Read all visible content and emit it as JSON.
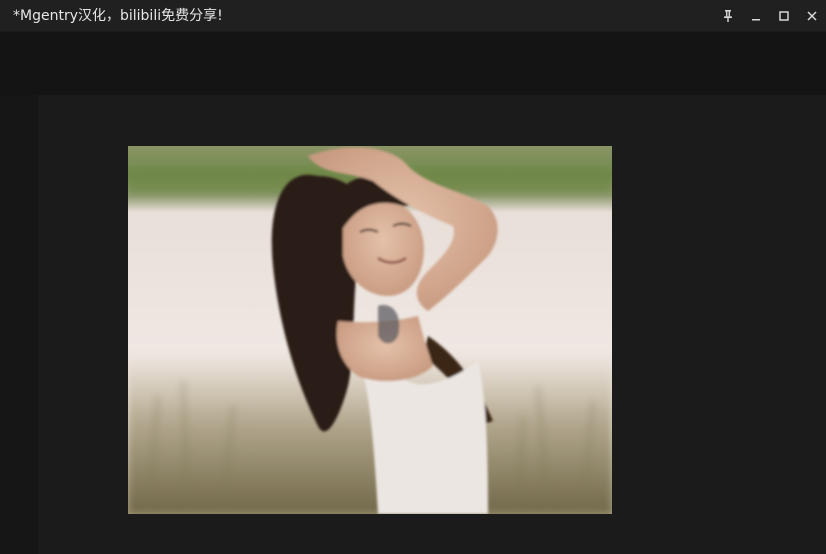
{
  "window": {
    "title": "*Mgentry汉化，bilibili免费分享!"
  },
  "controls": {
    "pin_icon": "pin-icon",
    "minimize_icon": "minimize-icon",
    "maximize_icon": "maximize-icon",
    "close_icon": "close-icon"
  },
  "colors": {
    "titlebar_bg": "#202020",
    "app_bg": "#141414",
    "canvas_bg": "#1b1b1b",
    "title_text": "#e6e6e6",
    "icon": "#d8d8d8"
  }
}
